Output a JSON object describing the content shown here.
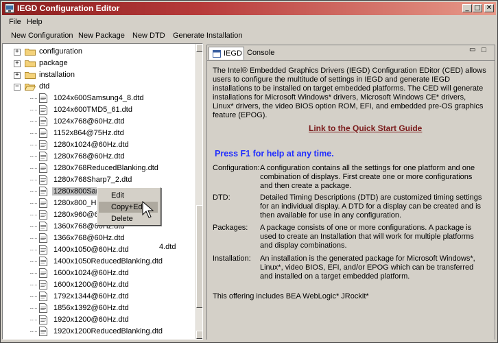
{
  "window": {
    "title": "IEGD Configuration Editor"
  },
  "title_buttons": {
    "minimize": "_",
    "maximize": "□",
    "close": "✕"
  },
  "menu": [
    "File",
    "Help"
  ],
  "toolbar": [
    "New Configuration",
    "New Package",
    "New DTD",
    "Generate Installation"
  ],
  "tree": {
    "folders": [
      "configuration",
      "package",
      "installation",
      "dtd"
    ],
    "expand_collapsed": "+",
    "expand_open": "−",
    "files": [
      "1024x600Samsung4_8.dtd",
      "1024x600TMD5_61.dtd",
      "1024x768@60Hz.dtd",
      "1152x864@75Hz.dtd",
      "1280x1024@60Hz.dtd",
      "1280x768@60Hz.dtd",
      "1280x768ReducedBlanking.dtd",
      "1280x768Sharp7_2.dtd",
      "1280x800Sam",
      "1280x800_H",
      "1280x960@6",
      "1360x768@60Hz.dtd",
      "1366x768@60Hz.dtd",
      "1400x1050@60Hz.dtd",
      "1400x1050ReducedBlanking.dtd",
      "1600x1024@60Hz.dtd",
      "1600x1200@60Hz.dtd",
      "1792x1344@60Hz.dtd",
      "1856x1392@60Hz.dtd",
      "1920x1200@60Hz.dtd",
      "1920x1200ReducedBlanking.dtd"
    ],
    "occluded_suffix": "4.dtd"
  },
  "context_menu": [
    "Edit",
    "Copy+Edit",
    "Delete"
  ],
  "tabs": [
    {
      "label": "IEGD",
      "active": true
    },
    {
      "label": "Console",
      "active": false
    }
  ],
  "pane_buttons": {
    "minimize": "▭",
    "maximize": "□"
  },
  "content": {
    "intro": "The Intel® Embedded Graphics Drivers (IEGD) Configuration EDitor (CED) allows users to configure the multitude of settings in IEGD and generate IEGD installations to be installed on target embedded platforms.  The CED will generate installations for Microsoft Windows* drivers, Microsoft Windows CE* drivers, Linux* drivers, the video BIOS option ROM, EFI, and embedded pre-OS graphics feature (EPOG).",
    "link": "Link to the Quick Start Guide",
    "f1_help": "Press F1 for help at any time.",
    "definitions": [
      {
        "term": "Configuration:",
        "desc": "A configuration contains all the settings for one platform and one combination of displays.  First create one or more configurations and then create a package."
      },
      {
        "term": "DTD:",
        "desc": "Detailed Timing Descriptions (DTD) are customized timing settings for an individual display.  A DTD for a display can be created and is then available for use in any configuration."
      },
      {
        "term": "Packages:",
        "desc": "A package consists of one or more configurations.  A package is used to create an Installation that will work for multiple platforms and display combinations."
      },
      {
        "term": "Installation:",
        "desc": "An installation is the generated package for Microsoft Windows*, Linux*, video BIOS, EFI, and/or EPOG which can be transferred and installed on a target embedded platform."
      }
    ],
    "footer": "This offering includes BEA WebLogic* JRockit*"
  },
  "colors": {
    "titlebar_start": "#8a1f1f",
    "link": "#7a1a1a",
    "f1": "#1f2dff",
    "window_bg": "#d4d0c8"
  }
}
